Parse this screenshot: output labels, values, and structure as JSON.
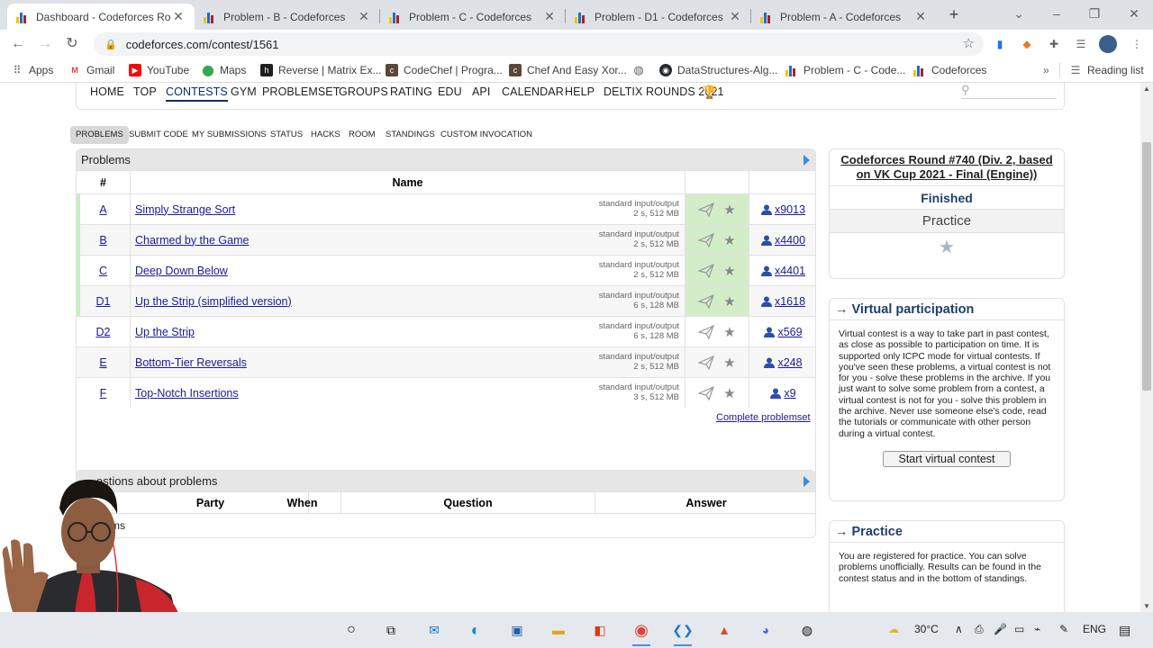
{
  "browser": {
    "tabs": [
      {
        "label": "Dashboard - Codeforces Rou",
        "active": true
      },
      {
        "label": "Problem - B - Codeforces",
        "active": false
      },
      {
        "label": "Problem - C - Codeforces",
        "active": false
      },
      {
        "label": "Problem - D1 - Codeforces",
        "active": false
      },
      {
        "label": "Problem - A - Codeforces",
        "active": false
      }
    ],
    "url": "codeforces.com/contest/1561",
    "bookmarks": [
      {
        "label": "Apps",
        "icon": "apps-grid-icon"
      },
      {
        "label": "Gmail",
        "icon": "gmail-icon"
      },
      {
        "label": "YouTube",
        "icon": "youtube-icon"
      },
      {
        "label": "Maps",
        "icon": "maps-icon"
      },
      {
        "label": "Reverse | Matrix Ex...",
        "icon": "h-icon"
      },
      {
        "label": "CodeChef | Progra...",
        "icon": "codechef-icon"
      },
      {
        "label": "Chef And Easy Xor...",
        "icon": "codechef-icon"
      },
      {
        "label": "",
        "icon": "globe-icon"
      },
      {
        "label": "DataStructures-Alg...",
        "icon": "github-icon"
      },
      {
        "label": "Problem - C - Code...",
        "icon": "codeforces-icon"
      },
      {
        "label": "Codeforces",
        "icon": "codeforces-icon"
      }
    ],
    "reading_list": "Reading list"
  },
  "site": {
    "menu": [
      "HOME",
      "TOP",
      "CONTESTS",
      "GYM",
      "PROBLEMSET",
      "GROUPS",
      "RATING",
      "EDU",
      "API",
      "CALENDAR",
      "HELP",
      "DELTIX ROUNDS 2021"
    ],
    "active_menu": "CONTESTS",
    "subnav": [
      "PROBLEMS",
      "SUBMIT CODE",
      "MY SUBMISSIONS",
      "STATUS",
      "HACKS",
      "ROOM",
      "STANDINGS",
      "CUSTOM INVOCATION"
    ]
  },
  "problems": {
    "title": "Problems",
    "col_index": "#",
    "col_name": "Name",
    "rows": [
      {
        "index": "A",
        "name": "Simply Strange Sort",
        "io": "standard input/output",
        "limits": "2 s, 512 MB",
        "solved": "x9013",
        "accepted": true
      },
      {
        "index": "B",
        "name": "Charmed by the Game",
        "io": "standard input/output",
        "limits": "2 s, 512 MB",
        "solved": "x4400",
        "accepted": true
      },
      {
        "index": "C",
        "name": "Deep Down Below",
        "io": "standard input/output",
        "limits": "2 s, 512 MB",
        "solved": "x4401",
        "accepted": true
      },
      {
        "index": "D1",
        "name": "Up the Strip (simplified version)",
        "io": "standard input/output",
        "limits": "6 s, 128 MB",
        "solved": "x1618",
        "accepted": true
      },
      {
        "index": "D2",
        "name": "Up the Strip",
        "io": "standard input/output",
        "limits": "6 s, 128 MB",
        "solved": "x569",
        "accepted": false
      },
      {
        "index": "E",
        "name": "Bottom-Tier Reversals",
        "io": "standard input/output",
        "limits": "2 s, 512 MB",
        "solved": "x248",
        "accepted": false
      },
      {
        "index": "F",
        "name": "Top-Notch Insertions",
        "io": "standard input/output",
        "limits": "3 s, 512 MB",
        "solved": "x9",
        "accepted": false
      }
    ],
    "complete_link": "Complete problemset"
  },
  "questions": {
    "title": "estions about problems",
    "cols": [
      "Party",
      "When",
      "Question",
      "Answer"
    ],
    "empty_text": "ms"
  },
  "contest": {
    "title": "Codeforces Round #740 (Div. 2, based on VK Cup 2021 - Final (Engine))",
    "status": "Finished",
    "mode": "Practice"
  },
  "virtual": {
    "title": "Virtual participation",
    "text": "Virtual contest is a way to take part in past contest, as close as possible to participation on time. It is supported only ICPC mode for virtual contests. If you've seen these problems, a virtual contest is not for you - solve these problems in the archive. If you just want to solve some problem from a contest, a virtual contest is not for you - solve this problem in the archive. Never use someone else's code, read the tutorials or communicate with other person during a virtual contest.",
    "button": "Start virtual contest"
  },
  "practice": {
    "title": "Practice",
    "text": "You are registered for practice. You can solve problems unofficially. Results can be found in the contest status and in the bottom of standings."
  },
  "taskbar": {
    "temperature": "30°C",
    "language": "ENG"
  }
}
